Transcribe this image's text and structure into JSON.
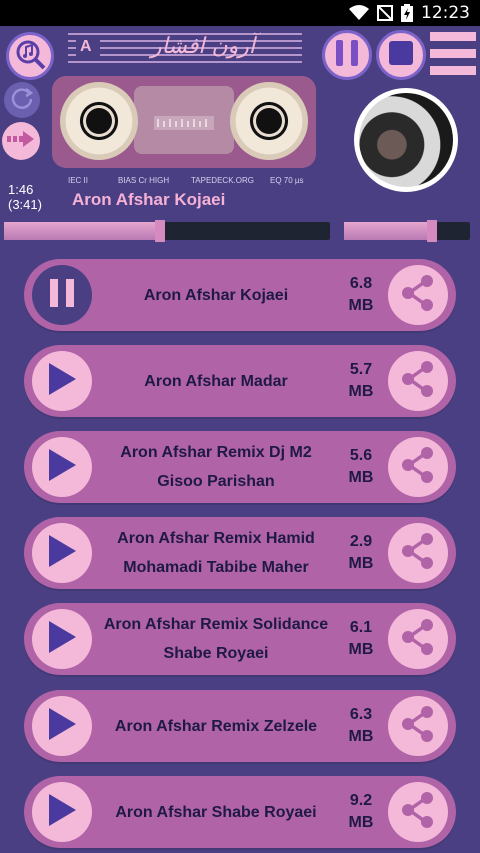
{
  "status_bar": {
    "time": "12:23"
  },
  "header": {
    "logo_text": "آرون افشار",
    "cassette_side": "A",
    "tape_labels": [
      "IEC II",
      "BIAS Cr HIGH",
      "TAPEDECK.ORG",
      "EQ 70 µs"
    ],
    "elapsed": "1:46",
    "duration": "(3:41)",
    "now_playing": "Aron Afshar Kojaei",
    "seek_progress": 0.48,
    "volume_level": 0.7
  },
  "tracks": [
    {
      "line1": "Aron Afshar Kojaei",
      "line2": "",
      "size1": "6.8",
      "size2": "MB",
      "playing": true
    },
    {
      "line1": "Aron Afshar Madar",
      "line2": "",
      "size1": "5.7",
      "size2": "MB",
      "playing": false
    },
    {
      "line1": "Aron Afshar Remix Dj M2",
      "line2": "Gisoo Parishan",
      "size1": "5.6",
      "size2": "MB",
      "playing": false
    },
    {
      "line1": "Aron Afshar Remix Hamid",
      "line2": "Mohamadi Tabibe Maher",
      "size1": "2.9",
      "size2": "MB",
      "playing": false
    },
    {
      "line1": "Aron Afshar Remix Solidance",
      "line2": "Shabe Royaei",
      "size1": "6.1",
      "size2": "MB",
      "playing": false
    },
    {
      "line1": "Aron Afshar Remix Zelzele",
      "line2": "",
      "size1": "6.3",
      "size2": "MB",
      "playing": false
    },
    {
      "line1": "Aron Afshar Shabe Royaei",
      "line2": "",
      "size1": "9.2",
      "size2": "MB",
      "playing": false
    }
  ],
  "icons": {
    "library": "music-search-icon",
    "repeat": "repeat-icon",
    "next": "arrow-right-icon",
    "pause": "pause-icon",
    "stop": "stop-icon",
    "menu": "menu-icon",
    "play": "play-icon",
    "share": "share-icon"
  },
  "colors": {
    "background": "#4a3f82",
    "track_bg": "#b063a7",
    "accent_pink": "#f4b8d9",
    "title_text": "#1f1a45",
    "now_playing": "#f6b2d6"
  }
}
